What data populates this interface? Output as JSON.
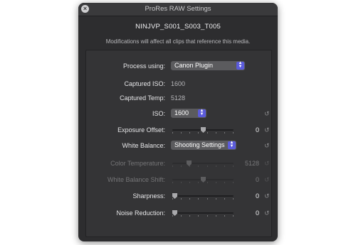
{
  "window": {
    "title": "ProRes RAW Settings",
    "close_icon": "close-icon"
  },
  "clip_name": "NINJVP_S001_S003_T005",
  "notice": "Modifications will affect all clips that reference this media.",
  "colors": {
    "window_bg": "#2d2d2f",
    "panel_bg": "#343436",
    "accent": "#5b5bdb"
  },
  "settings": {
    "process_using": {
      "label": "Process using:",
      "value": "Canon Plugin"
    },
    "captured_iso": {
      "label": "Captured ISO:",
      "value": "1600"
    },
    "captured_temp": {
      "label": "Captured Temp:",
      "value": "5128"
    },
    "iso": {
      "label": "ISO:",
      "value": "1600",
      "reset_icon": "reset-icon"
    },
    "exposure_offset": {
      "label": "Exposure Offset:",
      "value": "0",
      "level": 0.5
    },
    "white_balance": {
      "label": "White Balance:",
      "value": "Shooting Settings"
    },
    "color_temperature": {
      "label": "Color Temperature:",
      "value": "5128",
      "level": 0.25,
      "enabled": false
    },
    "white_balance_shift": {
      "label": "White Balance Shift:",
      "value": "0",
      "level": 0.5,
      "enabled": false
    },
    "sharpness": {
      "label": "Sharpness:",
      "value": "0",
      "level": 0.0
    },
    "noise_reduction": {
      "label": "Noise Reduction:",
      "value": "0",
      "level": 0.0
    }
  },
  "reset_glyph": "↺"
}
